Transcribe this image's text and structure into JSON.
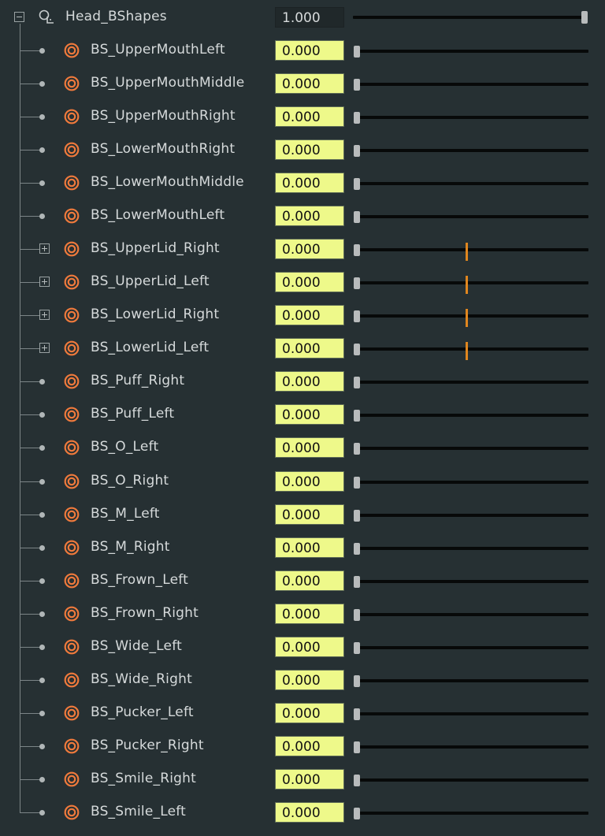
{
  "head": {
    "label": "Head_BShapes",
    "value": "1.000",
    "slider_fraction": 1.0,
    "expanded": true
  },
  "colors": {
    "background": "#263033",
    "value_field": "#eef98a",
    "key_marker": "#e0861e",
    "target_icon": "#f07a3c"
  },
  "icons": {
    "collapse": "minus-box-icon",
    "expand": "plus-box-icon",
    "group": "blendshape-group-icon",
    "target": "target-icon"
  },
  "shapes": [
    {
      "label": "BS_UpperMouthLeft",
      "value": "0.000",
      "slider_fraction": 0,
      "expandable": false,
      "key_marker_fraction": null
    },
    {
      "label": "BS_UpperMouthMiddle",
      "value": "0.000",
      "slider_fraction": 0,
      "expandable": false,
      "key_marker_fraction": null
    },
    {
      "label": "BS_UpperMouthRight",
      "value": "0.000",
      "slider_fraction": 0,
      "expandable": false,
      "key_marker_fraction": null
    },
    {
      "label": "BS_LowerMouthRight",
      "value": "0.000",
      "slider_fraction": 0,
      "expandable": false,
      "key_marker_fraction": null
    },
    {
      "label": "BS_LowerMouthMiddle",
      "value": "0.000",
      "slider_fraction": 0,
      "expandable": false,
      "key_marker_fraction": null
    },
    {
      "label": "BS_LowerMouthLeft",
      "value": "0.000",
      "slider_fraction": 0,
      "expandable": false,
      "key_marker_fraction": null
    },
    {
      "label": "BS_UpperLid_Right",
      "value": "0.000",
      "slider_fraction": 0,
      "expandable": true,
      "key_marker_fraction": 0.5
    },
    {
      "label": "BS_UpperLid_Left",
      "value": "0.000",
      "slider_fraction": 0,
      "expandable": true,
      "key_marker_fraction": 0.5
    },
    {
      "label": "BS_LowerLid_Right",
      "value": "0.000",
      "slider_fraction": 0,
      "expandable": true,
      "key_marker_fraction": 0.5
    },
    {
      "label": "BS_LowerLid_Left",
      "value": "0.000",
      "slider_fraction": 0,
      "expandable": true,
      "key_marker_fraction": 0.5
    },
    {
      "label": "BS_Puff_Right",
      "value": "0.000",
      "slider_fraction": 0,
      "expandable": false,
      "key_marker_fraction": null
    },
    {
      "label": "BS_Puff_Left",
      "value": "0.000",
      "slider_fraction": 0,
      "expandable": false,
      "key_marker_fraction": null
    },
    {
      "label": "BS_O_Left",
      "value": "0.000",
      "slider_fraction": 0,
      "expandable": false,
      "key_marker_fraction": null
    },
    {
      "label": "BS_O_Right",
      "value": "0.000",
      "slider_fraction": 0,
      "expandable": false,
      "key_marker_fraction": null
    },
    {
      "label": "BS_M_Left",
      "value": "0.000",
      "slider_fraction": 0,
      "expandable": false,
      "key_marker_fraction": null
    },
    {
      "label": "BS_M_Right",
      "value": "0.000",
      "slider_fraction": 0,
      "expandable": false,
      "key_marker_fraction": null
    },
    {
      "label": "BS_Frown_Left",
      "value": "0.000",
      "slider_fraction": 0,
      "expandable": false,
      "key_marker_fraction": null
    },
    {
      "label": "BS_Frown_Right",
      "value": "0.000",
      "slider_fraction": 0,
      "expandable": false,
      "key_marker_fraction": null
    },
    {
      "label": "BS_Wide_Left",
      "value": "0.000",
      "slider_fraction": 0,
      "expandable": false,
      "key_marker_fraction": null
    },
    {
      "label": "BS_Wide_Right",
      "value": "0.000",
      "slider_fraction": 0,
      "expandable": false,
      "key_marker_fraction": null
    },
    {
      "label": "BS_Pucker_Left",
      "value": "0.000",
      "slider_fraction": 0,
      "expandable": false,
      "key_marker_fraction": null
    },
    {
      "label": "BS_Pucker_Right",
      "value": "0.000",
      "slider_fraction": 0,
      "expandable": false,
      "key_marker_fraction": null
    },
    {
      "label": "BS_Smile_Right",
      "value": "0.000",
      "slider_fraction": 0,
      "expandable": false,
      "key_marker_fraction": null
    },
    {
      "label": "BS_Smile_Left",
      "value": "0.000",
      "slider_fraction": 0,
      "expandable": false,
      "key_marker_fraction": null
    }
  ]
}
